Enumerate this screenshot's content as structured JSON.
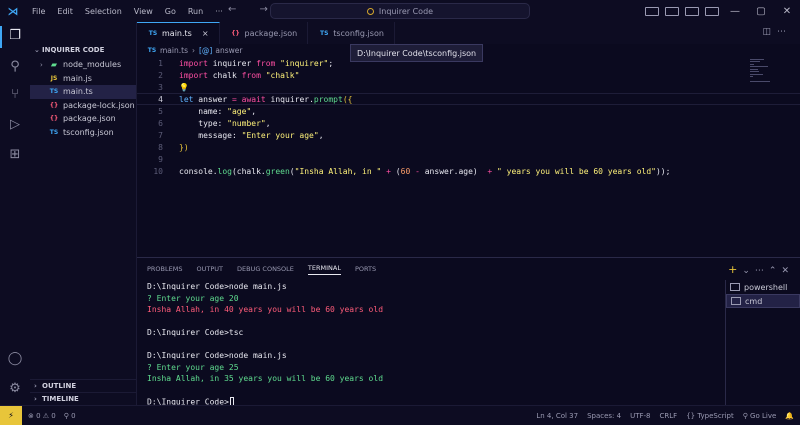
{
  "titlebar": {
    "menu": [
      "File",
      "Edit",
      "Selection",
      "View",
      "Go",
      "Run",
      "···"
    ],
    "nav": "← →",
    "search_text": "Inquirer Code"
  },
  "sidebar": {
    "header": "INQUIRER CODE",
    "items": [
      {
        "label": "node_modules",
        "icon": "folder-icon",
        "type": "folder"
      },
      {
        "label": "main.js",
        "icon": "JS",
        "type": "file"
      },
      {
        "label": "main.ts",
        "icon": "TS",
        "type": "file",
        "selected": true
      },
      {
        "label": "package-lock.json",
        "icon": "{}",
        "type": "file"
      },
      {
        "label": "package.json",
        "icon": "{}",
        "type": "file"
      },
      {
        "label": "tsconfig.json",
        "icon": "TS",
        "type": "file"
      }
    ],
    "sections": [
      "OUTLINE",
      "TIMELINE"
    ]
  },
  "tabs": [
    {
      "label": "main.ts",
      "icon": "TS",
      "active": true,
      "close": "×"
    },
    {
      "label": "package.json",
      "icon": "{}",
      "active": false
    },
    {
      "label": "tsconfig.json",
      "icon": "TS",
      "active": false
    }
  ],
  "tooltip": "D:\\Inquirer Code\\tsconfig.json",
  "breadcrumb": {
    "file": "main.ts",
    "file_icon": "TS",
    "symbol": "answer",
    "symbol_icon": "[@]"
  },
  "code": {
    "line_numbers": [
      "1",
      "2",
      "3",
      "4",
      "5",
      "6",
      "7",
      "8",
      "9",
      "10"
    ],
    "current_line": "4"
  },
  "panel": {
    "tabs": [
      "PROBLEMS",
      "OUTPUT",
      "DEBUG CONSOLE",
      "TERMINAL",
      "PORTS"
    ],
    "active_tab": "TERMINAL",
    "terminal_lines": [
      {
        "text": "D:\\Inquirer Code>node main.js",
        "kind": "prompt"
      },
      {
        "text": "? Enter your age 20",
        "kind": "question"
      },
      {
        "text": "Insha Allah, in 40 years you will be 60 years old",
        "kind": "red"
      },
      {
        "text": "",
        "kind": "prompt"
      },
      {
        "text": "D:\\Inquirer Code>tsc",
        "kind": "prompt"
      },
      {
        "text": "",
        "kind": "prompt"
      },
      {
        "text": "D:\\Inquirer Code>node main.js",
        "kind": "prompt"
      },
      {
        "text": "? Enter your age 25",
        "kind": "question"
      },
      {
        "text": "Insha Allah, in 35 years you will be 60 years old",
        "kind": "green"
      },
      {
        "text": "",
        "kind": "prompt"
      },
      {
        "text": "D:\\Inquirer Code>",
        "kind": "prompt",
        "cursor": true
      }
    ],
    "terminals": [
      {
        "label": "powershell",
        "selected": false
      },
      {
        "label": "cmd",
        "selected": true
      }
    ]
  },
  "statusbar": {
    "remote": "⚡",
    "errors": "⊗ 0 ⚠ 0",
    "ports": "⚲ 0",
    "position": "Ln 4, Col 37",
    "spaces": "Spaces: 4",
    "encoding": "UTF-8",
    "eol": "CRLF",
    "language": "{} TypeScript",
    "golive": "⚲ Go Live",
    "bell": "🔔"
  },
  "colors": {
    "accent": "#3fa7f5",
    "keyword": "#ff4fa3",
    "string": "#fff27a",
    "function": "#5fdc8f",
    "background": "#0b0a1f"
  }
}
